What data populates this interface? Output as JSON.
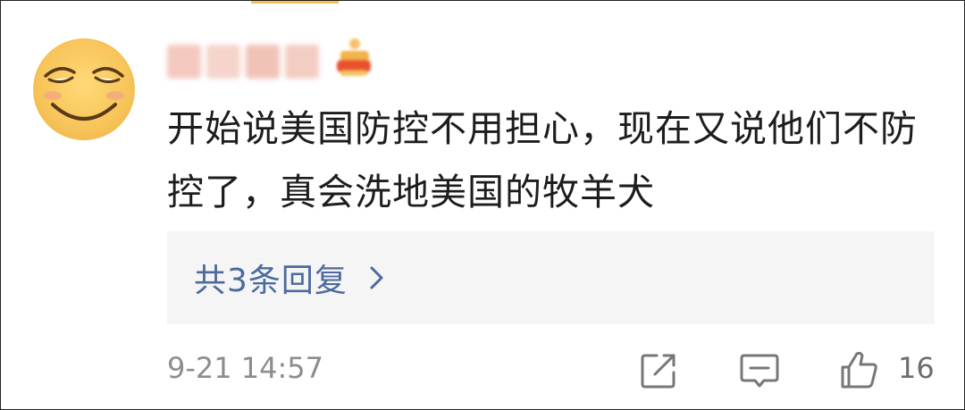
{
  "comment": {
    "text": "开始说美国防控不用担心，现在又说他们不防控了，真会洗地美国的牧羊犬",
    "replies_label": "共3条回复",
    "timestamp": "9-21 14:57",
    "like_count": "16"
  },
  "icons": {
    "avatar": "smiley-face-avatar",
    "badge": "vip-crown-icon",
    "chevron": "chevron-right-icon",
    "share": "share-icon",
    "comment": "comment-icon",
    "like": "thumbs-up-icon"
  },
  "colors": {
    "link": "#4c6a9c",
    "text": "#1d1d1d",
    "meta": "#8d8d8d",
    "reply_bg": "#f5f5f5"
  }
}
